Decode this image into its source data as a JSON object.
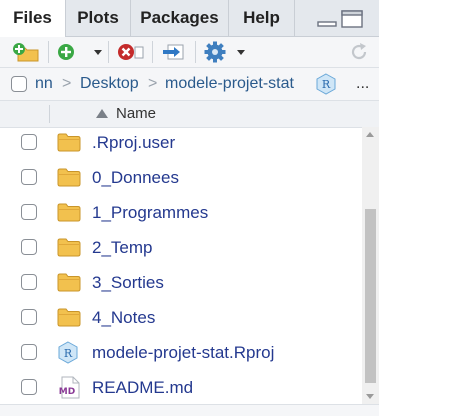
{
  "tabs": [
    {
      "label": "Files",
      "active": true
    },
    {
      "label": "Plots",
      "active": false
    },
    {
      "label": "Packages",
      "active": false
    },
    {
      "label": "Help",
      "active": false
    }
  ],
  "window_controls": [
    "minimize-icon",
    "maximize-icon"
  ],
  "toolbar": {
    "items": [
      "new-folder-icon",
      "new-blank-file-icon",
      "delete-icon",
      "rename-icon",
      "more-gear-icon",
      "refresh-icon"
    ]
  },
  "breadcrumb": {
    "items": [
      "nn",
      "Desktop",
      "modele-projet-stat"
    ],
    "separator": ">",
    "project_icon": "rproj-icon",
    "more_label": "..."
  },
  "columns": {
    "name_header": "Name",
    "sort": "ascending"
  },
  "files": [
    {
      "name": ".Rproj.user",
      "type": "folder"
    },
    {
      "name": "0_Donnees",
      "type": "folder"
    },
    {
      "name": "1_Programmes",
      "type": "folder"
    },
    {
      "name": "2_Temp",
      "type": "folder"
    },
    {
      "name": "3_Sorties",
      "type": "folder"
    },
    {
      "name": "4_Notes",
      "type": "folder"
    },
    {
      "name": "modele-projet-stat.Rproj",
      "type": "rproj"
    },
    {
      "name": "README.md",
      "type": "markdown"
    }
  ],
  "colors": {
    "link": "#24398f",
    "folder": "#f2c14e",
    "accent_green": "#3aa845",
    "accent_red": "#c42b2b",
    "gear_blue": "#3f7fbf"
  }
}
